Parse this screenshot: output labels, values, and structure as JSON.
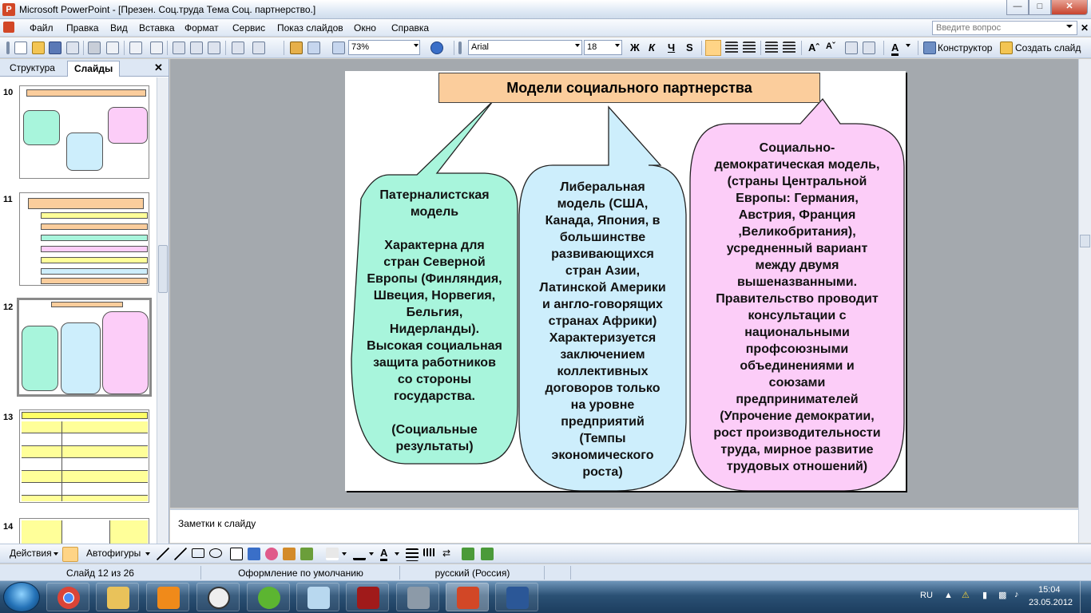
{
  "window": {
    "title": "Microsoft PowerPoint - [Презен. Соц.труда Тема Соц. партнерство.]",
    "app_icon": "powerpoint-icon"
  },
  "menu": {
    "items": [
      "Файл",
      "Правка",
      "Вид",
      "Вставка",
      "Формат",
      "Сервис",
      "Показ слайдов",
      "Окно",
      "Справка"
    ],
    "ask_placeholder": "Введите вопрос"
  },
  "toolbar": {
    "zoom": "73%",
    "font": "Arial",
    "size": "18",
    "bold": "Ж",
    "italic": "К",
    "underline": "Ч",
    "shadow": "S",
    "designer": "Конструктор",
    "new_slide": "Создать слайд"
  },
  "left_panel": {
    "tabs": [
      "Структура",
      "Слайды"
    ],
    "slides": [
      {
        "num": "10"
      },
      {
        "num": "11"
      },
      {
        "num": "12",
        "selected": true
      },
      {
        "num": "13"
      },
      {
        "num": "14"
      }
    ]
  },
  "slide": {
    "title": "Модели социального партнерства",
    "bubbles": [
      {
        "color": "#a8f5dc",
        "text": "Патерналистская\nмодель\n\nХарактерна для\nстран Северной\nЕвропы (Финляндия,\nШвеция, Норвегия,\nБельгия,\nНидерланды).\nВысокая социальная\nзащита работников\nсо стороны\nгосударства.\n\n(Социальные\nрезультаты)"
      },
      {
        "color": "#cdeefc",
        "text": "Либеральная\nмодель (США,\nКанада, Япония, в\nбольшинстве\nразвивающихся\nстран Азии,\nЛатинской Америки\nи англо-говорящих\nстранах Африки)\nХарактеризуется\nзаключением\nколлективных\nдоговоров только\nна уровне\nпредприятий\n(Темпы\nэкономического\nроста)"
      },
      {
        "color": "#fccdf8",
        "text": "Социально-\nдемократическая модель,\n(страны Центральной\nЕвропы: Германия,\nАвстрия, Франция\n,Великобритания),\nусредненный вариант\nмежду двумя\nвышеназванными.\nПравительство проводит\nконсультации с\nнациональными\nпрофсоюзными\nобъединениями и\nсоюзами\nпредпринимателей\n(Упрочение демократии,\nрост производительности\nтруда, мирное развитие\nтрудовых отношений)"
      }
    ]
  },
  "notes": {
    "placeholder": "Заметки к слайду"
  },
  "drawbar": {
    "actions": "Действия",
    "autoshapes": "Автофигуры"
  },
  "status": {
    "slide": "Слайд 12 из 26",
    "design": "Оформление по умолчанию",
    "language": "русский (Россия)"
  },
  "taskbar": {
    "apps": [
      "chrome-icon",
      "explorer-icon",
      "media-player-icon",
      "clock-icon",
      "utorrent-icon",
      "notepad-icon",
      "game-icon",
      "game2-icon",
      "powerpoint-icon",
      "word-icon"
    ],
    "lang": "RU",
    "time": "15:04",
    "date": "23.05.2012"
  }
}
